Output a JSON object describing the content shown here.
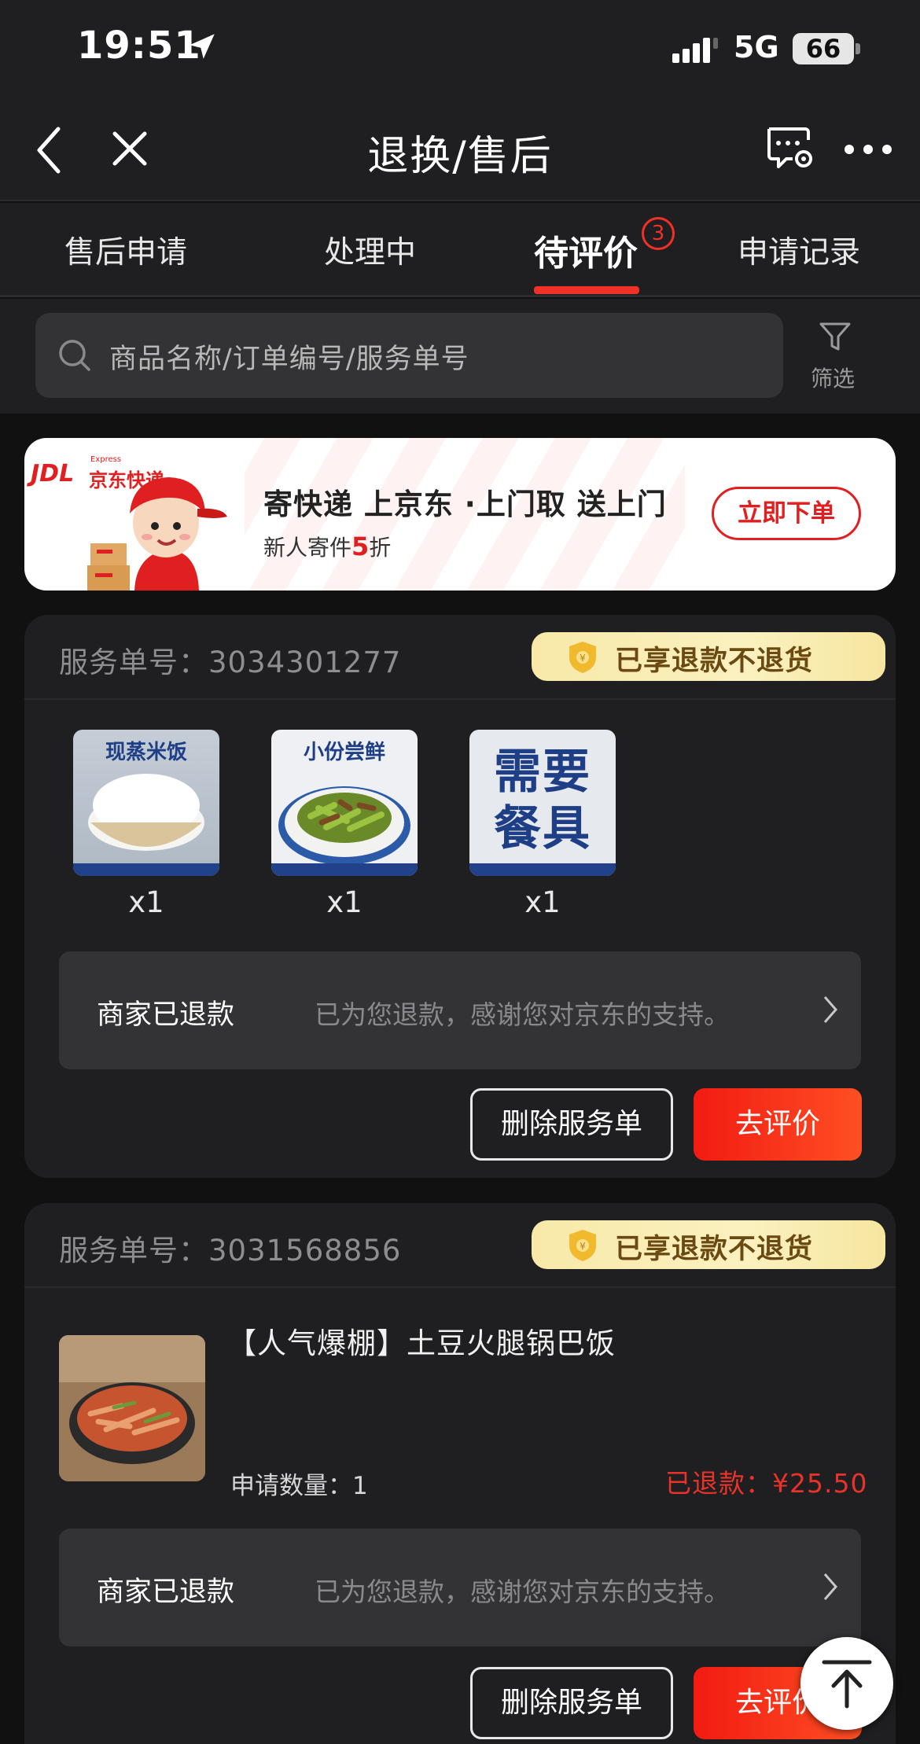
{
  "status_bar": {
    "time": "19:51",
    "network": "5G",
    "battery": "66"
  },
  "nav": {
    "title": "退换/售后"
  },
  "tabs": [
    {
      "label": "售后申请"
    },
    {
      "label": "处理中"
    },
    {
      "label": "待评价",
      "badge": "3",
      "active": true
    },
    {
      "label": "申请记录"
    }
  ],
  "search": {
    "placeholder": "商品名称/订单编号/服务单号",
    "filter_label": "筛选"
  },
  "banner": {
    "logo_text": "JDL",
    "logo_sub": "京东快递",
    "logo_en": "Express",
    "title": "寄快递 上京东 ·上门取 送上门",
    "subtitle_prefix": "新人寄件",
    "subtitle_highlight": "5",
    "subtitle_suffix": "折",
    "button": "立即下单"
  },
  "orders": [
    {
      "service_label": "服务单号：",
      "service_no": "3034301277",
      "refund_badge": "已享退款不退货",
      "items": [
        {
          "caption": "现蒸米饭",
          "qty": "x1",
          "icon": "rice-bowl-image"
        },
        {
          "caption": "小份尝鲜",
          "qty": "x1",
          "icon": "stir-fry-dish-image"
        },
        {
          "caption": "需要餐具",
          "qty": "x1",
          "icon": "utensils-text-image"
        }
      ],
      "status": "商家已退款",
      "status_desc": "已为您退款，感谢您对京东的支持。",
      "delete_label": "删除服务单",
      "review_label": "去评价"
    },
    {
      "service_label": "服务单号：",
      "service_no": "3031568856",
      "refund_badge": "已享退款不退货",
      "product_name": "【人气爆棚】土豆火腿锅巴饭",
      "apply_qty_label": "申请数量：",
      "apply_qty": "1",
      "refunded_label": "已退款：",
      "refunded_amount": "¥25.50",
      "status": "商家已退款",
      "status_desc": "已为您退款，感谢您对京东的支持。",
      "delete_label": "删除服务单",
      "review_label": "去评价"
    }
  ],
  "colors": {
    "accent": "#f03127",
    "background": "#111111",
    "card": "#1f1f21",
    "badge_gold": "#f8e9a8"
  }
}
